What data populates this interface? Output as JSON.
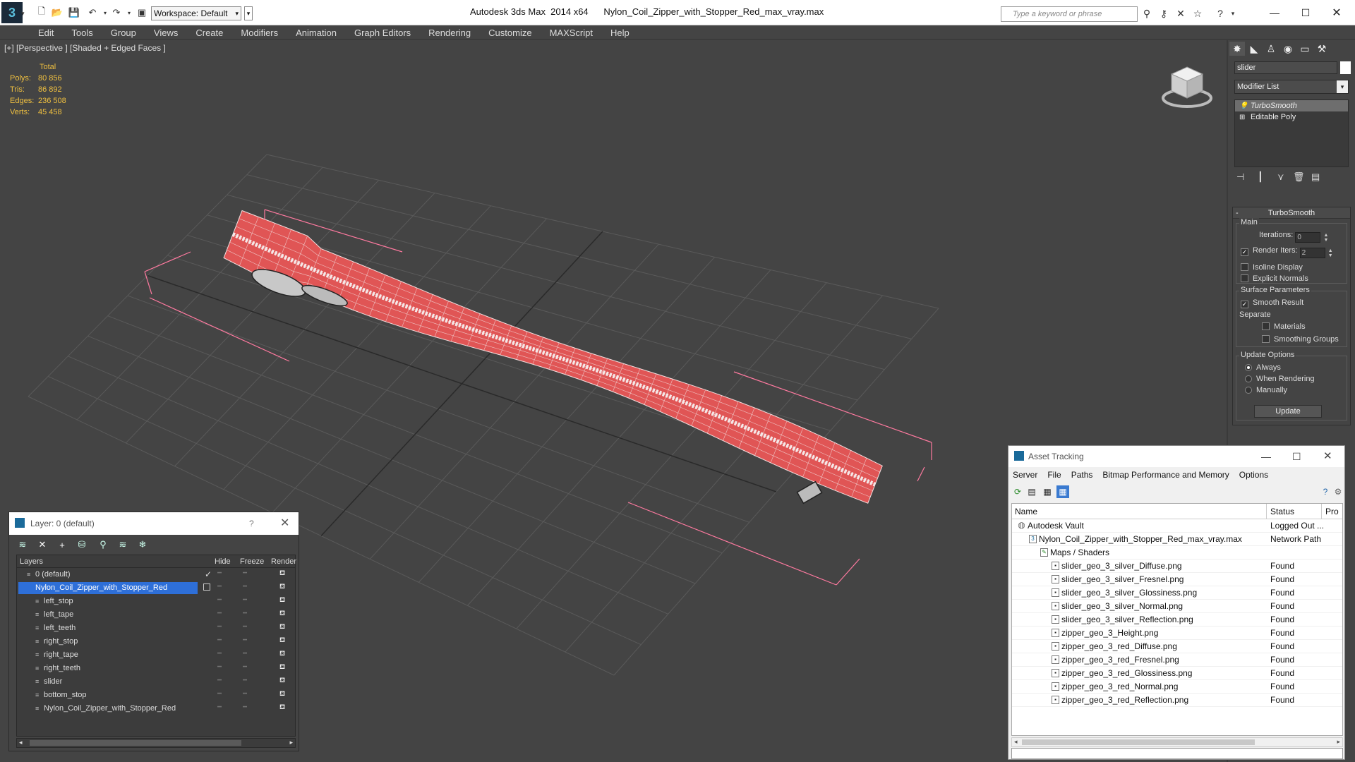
{
  "titlebar": {
    "app_title": "Autodesk 3ds Max  2014 x64      Nylon_Coil_Zipper_with_Stopper_Red_max_vray.max",
    "workspace": "Workspace: Default",
    "search_placeholder": "Type a keyword or phrase",
    "icons": [
      "binoculars-icon",
      "key-icon",
      "community-icon",
      "star-icon",
      "help-icon"
    ]
  },
  "menu": [
    "Edit",
    "Tools",
    "Group",
    "Views",
    "Create",
    "Modifiers",
    "Animation",
    "Graph Editors",
    "Rendering",
    "Customize",
    "MAXScript",
    "Help"
  ],
  "viewport": {
    "label": "[+] [Perspective ] [Shaded + Edged Faces ]",
    "stats": {
      "header": "Total",
      "rows": [
        {
          "label": "Polys:",
          "value": "80 856"
        },
        {
          "label": "Tris:",
          "value": "86 892"
        },
        {
          "label": "Edges:",
          "value": "236 508"
        },
        {
          "label": "Verts:",
          "value": "45 458"
        }
      ]
    },
    "colors": {
      "mesh": "#e05555",
      "wire": "#f2dede",
      "bbox": "#ff7aa0",
      "grid": "#5a5a5a",
      "gridaxis": "#2a2a2a"
    }
  },
  "command_panel": {
    "object_name": "slider",
    "modifier_list": "Modifier List",
    "stack": [
      {
        "label": "TurboSmooth"
      },
      {
        "label": "Editable Poly"
      }
    ],
    "turbosmooth": {
      "title": "TurboSmooth",
      "main": "Main",
      "iterations_label": "Iterations:",
      "iterations_value": "0",
      "render_iters_label": "Render Iters:",
      "render_iters_value": "2",
      "isoline": "Isoline Display",
      "explicit": "Explicit Normals",
      "surface_params": "Surface Parameters",
      "smooth_result": "Smooth Result",
      "separate": "Separate",
      "materials": "Materials",
      "smoothing_groups": "Smoothing Groups",
      "update_options": "Update Options",
      "always": "Always",
      "when_rendering": "When Rendering",
      "manually": "Manually",
      "update": "Update"
    }
  },
  "layer_dialog": {
    "title": "Layer: 0 (default)",
    "help": "?",
    "columns": {
      "layers": "Layers",
      "hide": "Hide",
      "freeze": "Freeze",
      "render": "Render"
    },
    "rows": [
      {
        "name": "0 (default)",
        "indent": 0,
        "selected": false,
        "current": true
      },
      {
        "name": "Nylon_Coil_Zipper_with_Stopper_Red",
        "indent": 0,
        "selected": true,
        "current": false
      },
      {
        "name": "left_stop",
        "indent": 1
      },
      {
        "name": "left_tape",
        "indent": 1
      },
      {
        "name": "left_teeth",
        "indent": 1
      },
      {
        "name": "right_stop",
        "indent": 1
      },
      {
        "name": "right_tape",
        "indent": 1
      },
      {
        "name": "right_teeth",
        "indent": 1
      },
      {
        "name": "slider",
        "indent": 1
      },
      {
        "name": "bottom_stop",
        "indent": 1
      },
      {
        "name": "Nylon_Coil_Zipper_with_Stopper_Red",
        "indent": 1
      }
    ]
  },
  "asset_dialog": {
    "title": "Asset Tracking",
    "menu": [
      "Server",
      "File",
      "Paths",
      "Bitmap Performance and Memory",
      "Options"
    ],
    "columns": {
      "name": "Name",
      "status": "Status",
      "pro": "Pro"
    },
    "rows": [
      {
        "name": "Autodesk Vault",
        "status": "Logged Out ...",
        "level": 0
      },
      {
        "name": "Nylon_Coil_Zipper_with_Stopper_Red_max_vray.max",
        "status": "Network Path",
        "level": 1
      },
      {
        "name": "Maps / Shaders",
        "status": "",
        "level": 2
      },
      {
        "name": "slider_geo_3_silver_Diffuse.png",
        "status": "Found",
        "level": 3
      },
      {
        "name": "slider_geo_3_silver_Fresnel.png",
        "status": "Found",
        "level": 3
      },
      {
        "name": "slider_geo_3_silver_Glossiness.png",
        "status": "Found",
        "level": 3
      },
      {
        "name": "slider_geo_3_silver_Normal.png",
        "status": "Found",
        "level": 3
      },
      {
        "name": "slider_geo_3_silver_Reflection.png",
        "status": "Found",
        "level": 3
      },
      {
        "name": "zipper_geo_3_Height.png",
        "status": "Found",
        "level": 3
      },
      {
        "name": "zipper_geo_3_red_Diffuse.png",
        "status": "Found",
        "level": 3
      },
      {
        "name": "zipper_geo_3_red_Fresnel.png",
        "status": "Found",
        "level": 3
      },
      {
        "name": "zipper_geo_3_red_Glossiness.png",
        "status": "Found",
        "level": 3
      },
      {
        "name": "zipper_geo_3_red_Normal.png",
        "status": "Found",
        "level": 3
      },
      {
        "name": "zipper_geo_3_red_Reflection.png",
        "status": "Found",
        "level": 3
      }
    ]
  }
}
